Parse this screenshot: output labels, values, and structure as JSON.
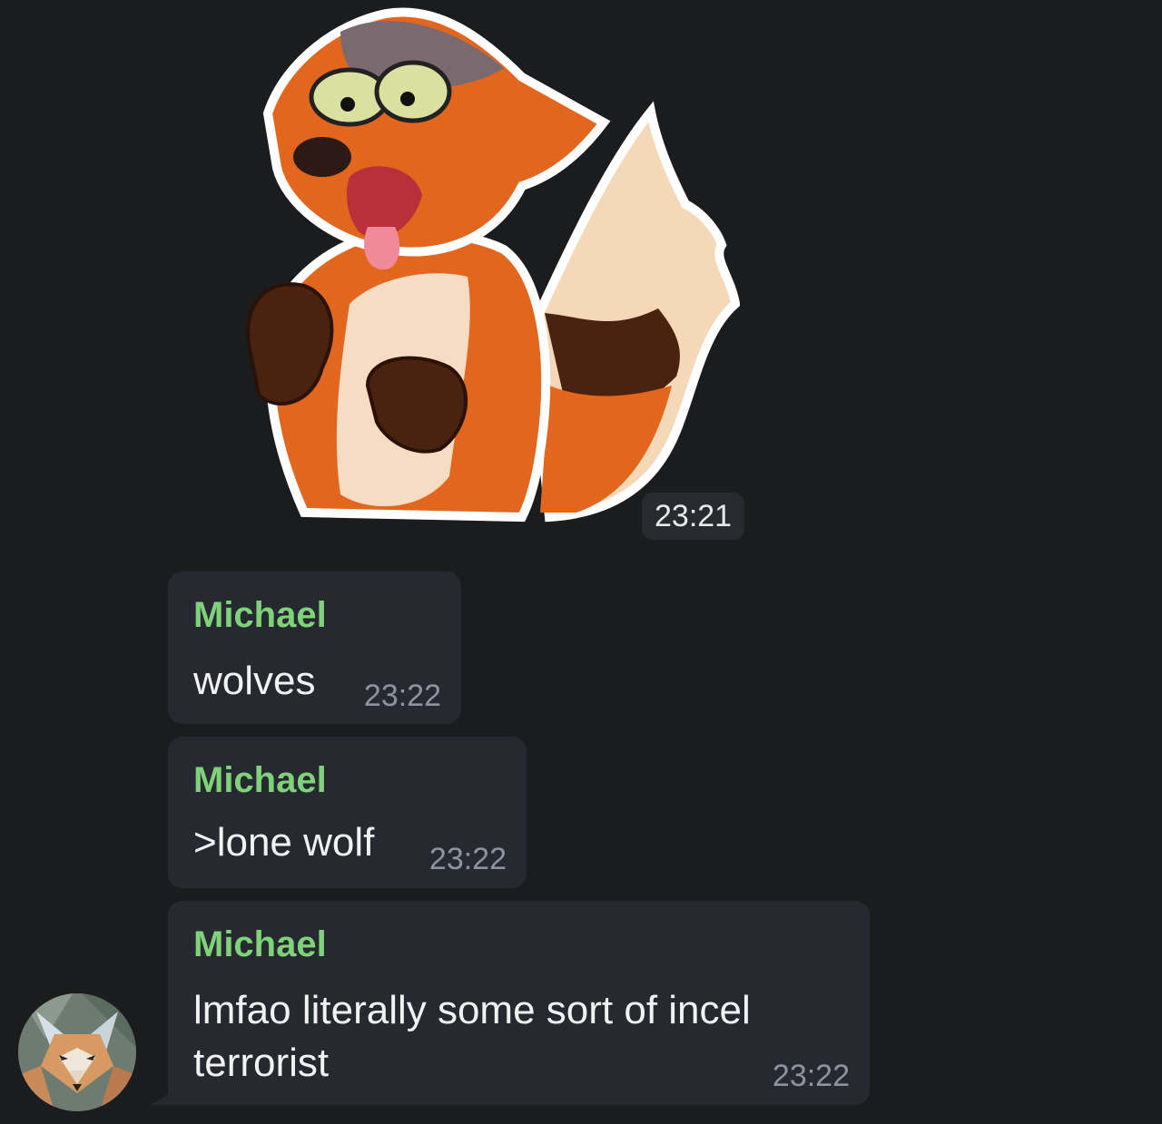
{
  "sticker": {
    "time": "23:21"
  },
  "messages": [
    {
      "sender": "Michael",
      "text": "wolves",
      "time": "23:22"
    },
    {
      "sender": "Michael",
      "text": ">lone wolf",
      "time": "23:22"
    },
    {
      "sender": "Michael",
      "text": "lmfao literally some sort of incel terrorist",
      "time": "23:22"
    }
  ],
  "colors": {
    "background": "#1b1c1e",
    "bubble": "#262a30",
    "sender_name": "#7fd17a",
    "time_text": "#8d949c"
  },
  "icons": {
    "avatar": "fox-avatar",
    "sticker": "fox-sticker"
  }
}
